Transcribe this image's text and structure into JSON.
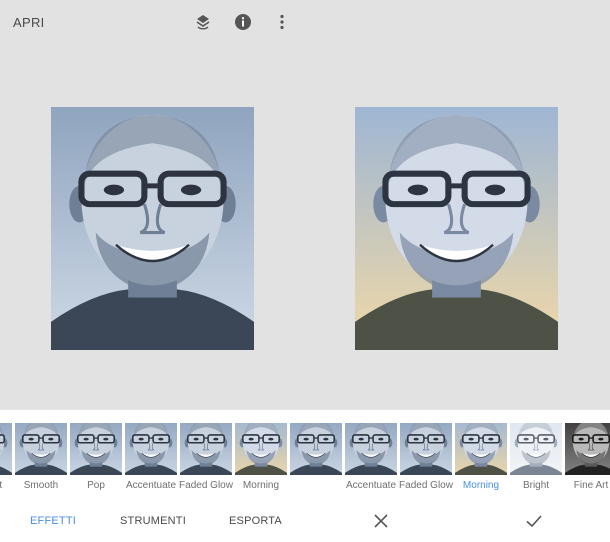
{
  "topbar": {
    "open_label": "APRI",
    "icons": [
      "layers-undo-icon",
      "info-icon",
      "more-vert-icon"
    ]
  },
  "photos": [
    {
      "name": "original-photo",
      "tone": "cool"
    },
    {
      "name": "edited-photo",
      "tone": "warm"
    }
  ],
  "filmstrip": {
    "items": [
      {
        "label": "Portrait",
        "tone": "cool"
      },
      {
        "label": "Smooth",
        "tone": "cool"
      },
      {
        "label": "Pop",
        "tone": "cool"
      },
      {
        "label": "Accentuate",
        "tone": "cool"
      },
      {
        "label": "Faded Glow",
        "tone": "cool"
      },
      {
        "label": "Morning",
        "tone": "warm"
      },
      {
        "label": "",
        "tone": "cool"
      },
      {
        "label": "Accentuate",
        "tone": "cool"
      },
      {
        "label": "Faded Glow",
        "tone": "cool"
      },
      {
        "label": "Morning",
        "tone": "warm",
        "selected": true
      },
      {
        "label": "Bright",
        "tone": "bright"
      },
      {
        "label": "Fine Art",
        "tone": "mono"
      },
      {
        "label": "",
        "tone": "mono"
      }
    ]
  },
  "bottombar": {
    "tabs": [
      "EFFETTI",
      "STRUMENTI",
      "ESPORTA"
    ],
    "active_tab": "EFFETTI",
    "cancel_icon": "close-icon",
    "apply_icon": "check-icon"
  },
  "colors": {
    "accent": "#4a8de0",
    "background": "#e2e2e2",
    "text": "#4a4a4a"
  }
}
